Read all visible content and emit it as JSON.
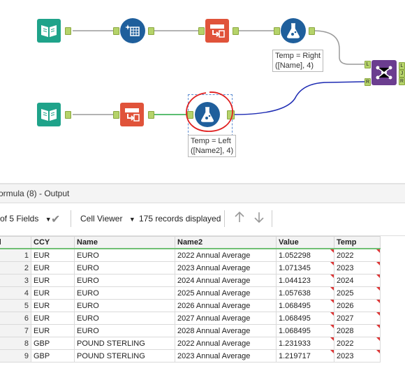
{
  "canvas": {
    "annotations": {
      "formula_right": "Temp = Right\n([Name], 4)",
      "formula_left": "Temp = Left\n([Name2], 4)"
    },
    "join_anchors": {
      "in_left": "L",
      "in_right": "R",
      "out_left": "L",
      "out_join": "J",
      "out_right": "R"
    },
    "colors": {
      "input": "#1fa38a",
      "formula": "#1f5f9c",
      "transpose": "#e0533a",
      "join": "#6b3d8f",
      "selected_circle": "#e02020"
    }
  },
  "results": {
    "title": "ormula (8) - Output",
    "toolbar": {
      "fields_label": "of 5 Fields",
      "viewer_label": "Cell Viewer",
      "records_label": "175 records displayed"
    },
    "columns": [
      "ord",
      "CCY",
      "Name",
      "Name2",
      "Value",
      "Temp"
    ],
    "rows": [
      [
        "1",
        "EUR",
        "EURO",
        "2022 Annual Average",
        "1.052298",
        "2022"
      ],
      [
        "2",
        "EUR",
        "EURO",
        "2023 Annual Average",
        "1.071345",
        "2023"
      ],
      [
        "3",
        "EUR",
        "EURO",
        "2024 Annual Average",
        "1.044123",
        "2024"
      ],
      [
        "4",
        "EUR",
        "EURO",
        "2025 Annual Average",
        "1.057638",
        "2025"
      ],
      [
        "5",
        "EUR",
        "EURO",
        "2026 Annual Average",
        "1.068495",
        "2026"
      ],
      [
        "6",
        "EUR",
        "EURO",
        "2027 Annual Average",
        "1.068495",
        "2027"
      ],
      [
        "7",
        "EUR",
        "EURO",
        "2028 Annual Average",
        "1.068495",
        "2028"
      ],
      [
        "8",
        "GBP",
        "POUND STERLING",
        "2022 Annual Average",
        "1.231933",
        "2022"
      ],
      [
        "9",
        "GBP",
        "POUND STERLING",
        "2023 Annual Average",
        "1.219717",
        "2023"
      ]
    ]
  }
}
